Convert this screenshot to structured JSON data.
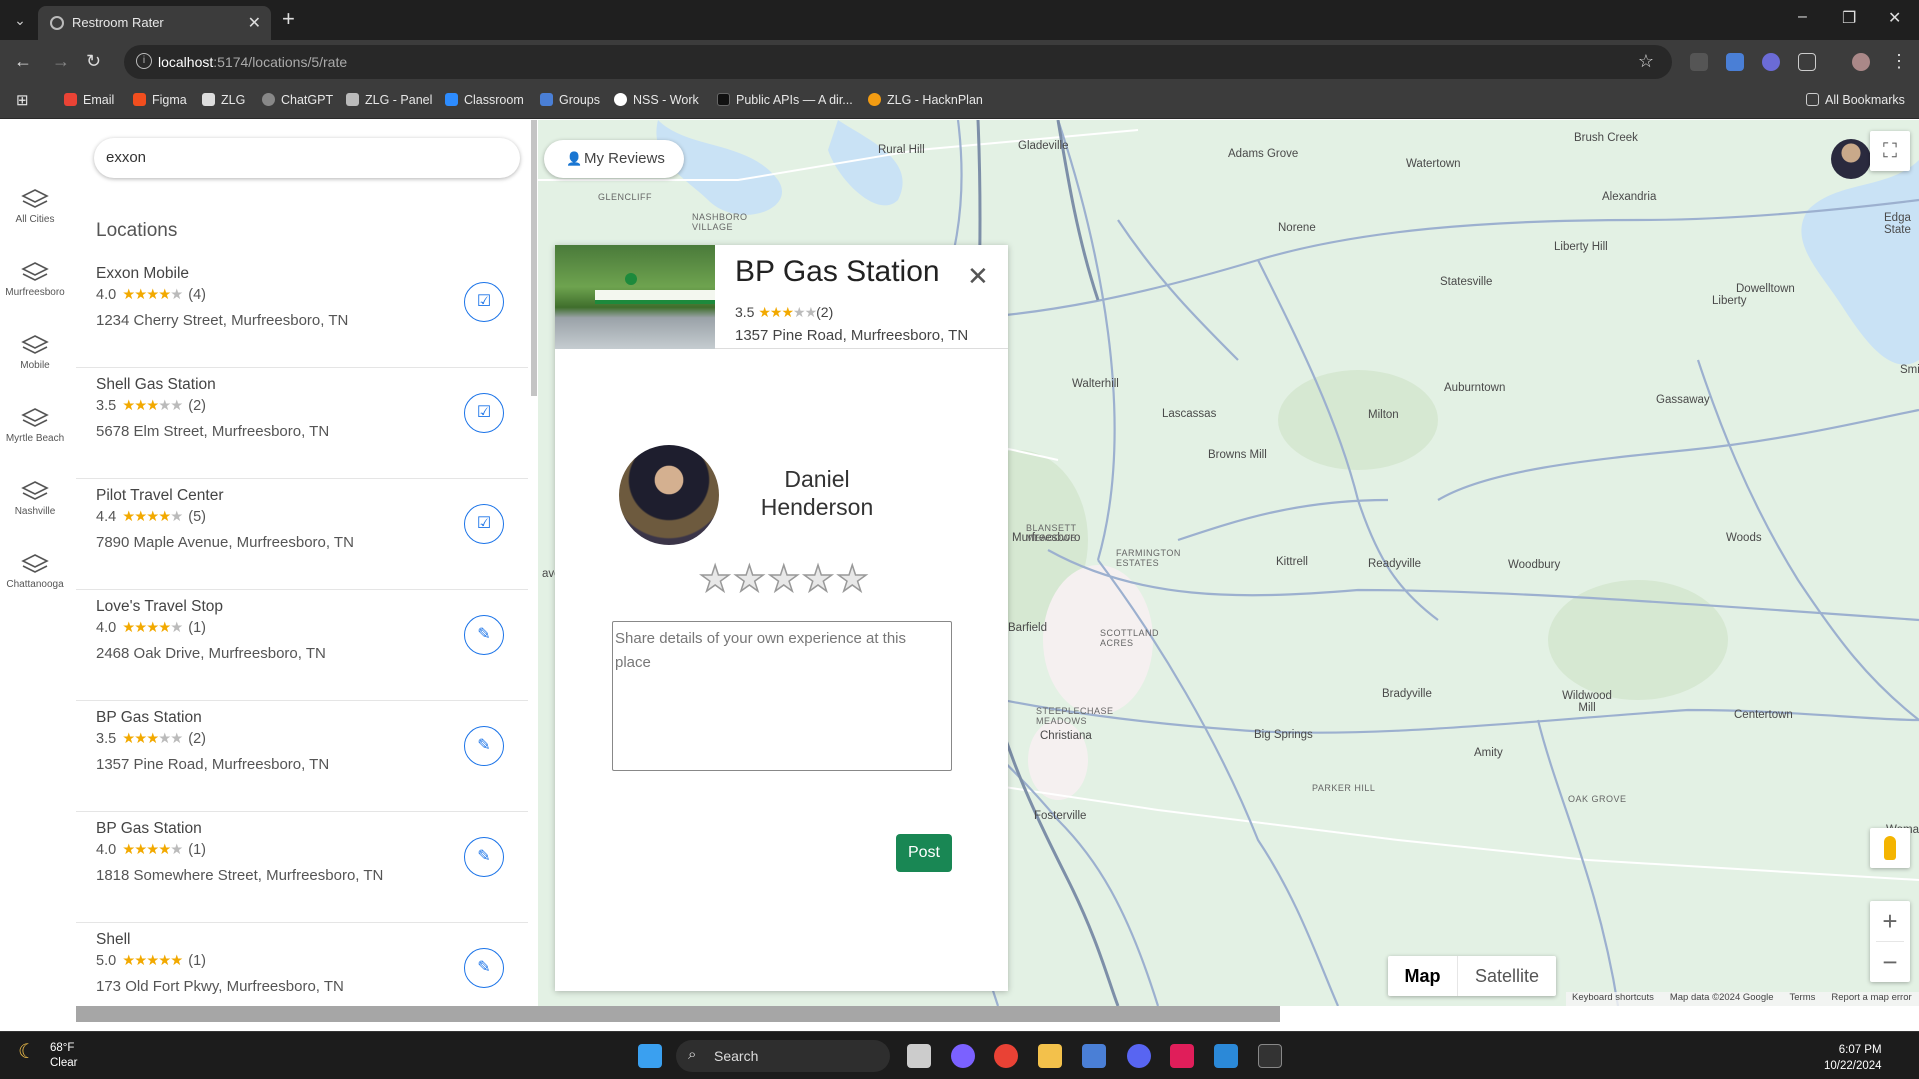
{
  "browser": {
    "tab_title": "Restroom Rater",
    "url_host": "localhost",
    "url_rest": ":5174/locations/5/rate",
    "bookmarks": [
      "Email",
      "Figma",
      "ZLG",
      "ChatGPT",
      "ZLG - Panel",
      "Classroom",
      "Groups",
      "NSS - Work",
      "Public APIs — A dir...",
      "ZLG - HacknPlan"
    ],
    "all_bookmarks": "All Bookmarks"
  },
  "rail": {
    "items": [
      "All Cities",
      "Murfreesboro",
      "Mobile",
      "Myrtle Beach",
      "Nashville",
      "Chattanooga"
    ]
  },
  "search": {
    "value": "exxon"
  },
  "sidebar": {
    "heading": "Locations",
    "locations": [
      {
        "name": "Exxon Mobile",
        "rating": "4.0",
        "stars": 4,
        "count": "(4)",
        "address": "1234 Cherry Street, Murfreesboro, TN",
        "action": "check"
      },
      {
        "name": "Shell Gas Station",
        "rating": "3.5",
        "stars": 3.5,
        "count": "(2)",
        "address": "5678 Elm Street, Murfreesboro, TN",
        "action": "check"
      },
      {
        "name": "Pilot Travel Center",
        "rating": "4.4",
        "stars": 4.5,
        "count": "(5)",
        "address": "7890 Maple Avenue, Murfreesboro, TN",
        "action": "check"
      },
      {
        "name": "Love's Travel Stop",
        "rating": "4.0",
        "stars": 4,
        "count": "(1)",
        "address": "2468 Oak Drive, Murfreesboro, TN",
        "action": "edit"
      },
      {
        "name": "BP Gas Station",
        "rating": "3.5",
        "stars": 3.5,
        "count": "(2)",
        "address": "1357 Pine Road, Murfreesboro, TN",
        "action": "edit"
      },
      {
        "name": "BP Gas Station",
        "rating": "4.0",
        "stars": 4,
        "count": "(1)",
        "address": "1818 Somewhere Street, Murfreesboro, TN",
        "action": "edit"
      },
      {
        "name": "Shell",
        "rating": "5.0",
        "stars": 5,
        "count": "(1)",
        "address": "173 Old Fort Pkwy, Murfreesboro, TN",
        "action": "edit"
      }
    ]
  },
  "map": {
    "my_reviews": "My Reviews",
    "map_label": "Map",
    "satellite_label": "Satellite",
    "attribution": [
      "Keyboard shortcuts",
      "Map data ©2024 Google",
      "Terms",
      "Report a map error"
    ],
    "towns": [
      "Rural Hill",
      "Gladeville",
      "Adams Grove",
      "Watertown",
      "Brush Creek",
      "Alexandria",
      "Norene",
      "Liberty Hill",
      "Statesville",
      "Dowelltown",
      "Liberty",
      "Walterhill",
      "Lascassas",
      "Milton",
      "Auburntown",
      "Gassaway",
      "Browns Mill",
      "Murfreesboro",
      "Kittrell",
      "Readyville",
      "Woodbury",
      "Woods",
      "Barfield",
      "Bradyville",
      "Wildwood Mill",
      "Centertown",
      "Christiana",
      "Big Springs",
      "Amity",
      "Fosterville",
      "GLENCLIFF",
      "NASHBORO VILLAGE",
      "BLANSETT MEADOWS",
      "FARMINGTON ESTATES",
      "SCOTTLAND ACRES",
      "STEEPLECHASE MEADOWS",
      "PARKER HILL",
      "OAK GROVE",
      "Smit",
      "Edga State",
      "Womac",
      "aven"
    ]
  },
  "card": {
    "title": "BP Gas Station",
    "rating": "3.5",
    "stars": 3.5,
    "count": "(2)",
    "address": "1357 Pine Road, Murfreesboro, TN",
    "user_name": "Daniel Henderson",
    "review_placeholder": "Share details of your own experience at this place",
    "post_label": "Post"
  },
  "taskbar": {
    "temp": "68°F",
    "condition": "Clear",
    "search_label": "Search",
    "time": "6:07 PM",
    "date": "10/22/2024"
  },
  "colors": {
    "accent": "#1a73e8",
    "star": "#f2a900",
    "post": "#198754"
  }
}
